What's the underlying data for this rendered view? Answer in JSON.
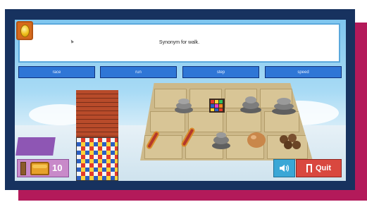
{
  "question": {
    "text": "Synonym for walk."
  },
  "answers": [
    {
      "label": "race"
    },
    {
      "label": "run"
    },
    {
      "label": "step"
    },
    {
      "label": "speed"
    }
  ],
  "hud": {
    "coin_count": "10"
  },
  "controls": {
    "sound_icon": "speaker-icon",
    "quit_label": "Quit"
  },
  "colors": {
    "frame": "#17325f",
    "accent": "#b31a5a",
    "answer_button": "#2f76d6",
    "quit_button": "#d9483f",
    "sound_button": "#3aa7d6"
  }
}
